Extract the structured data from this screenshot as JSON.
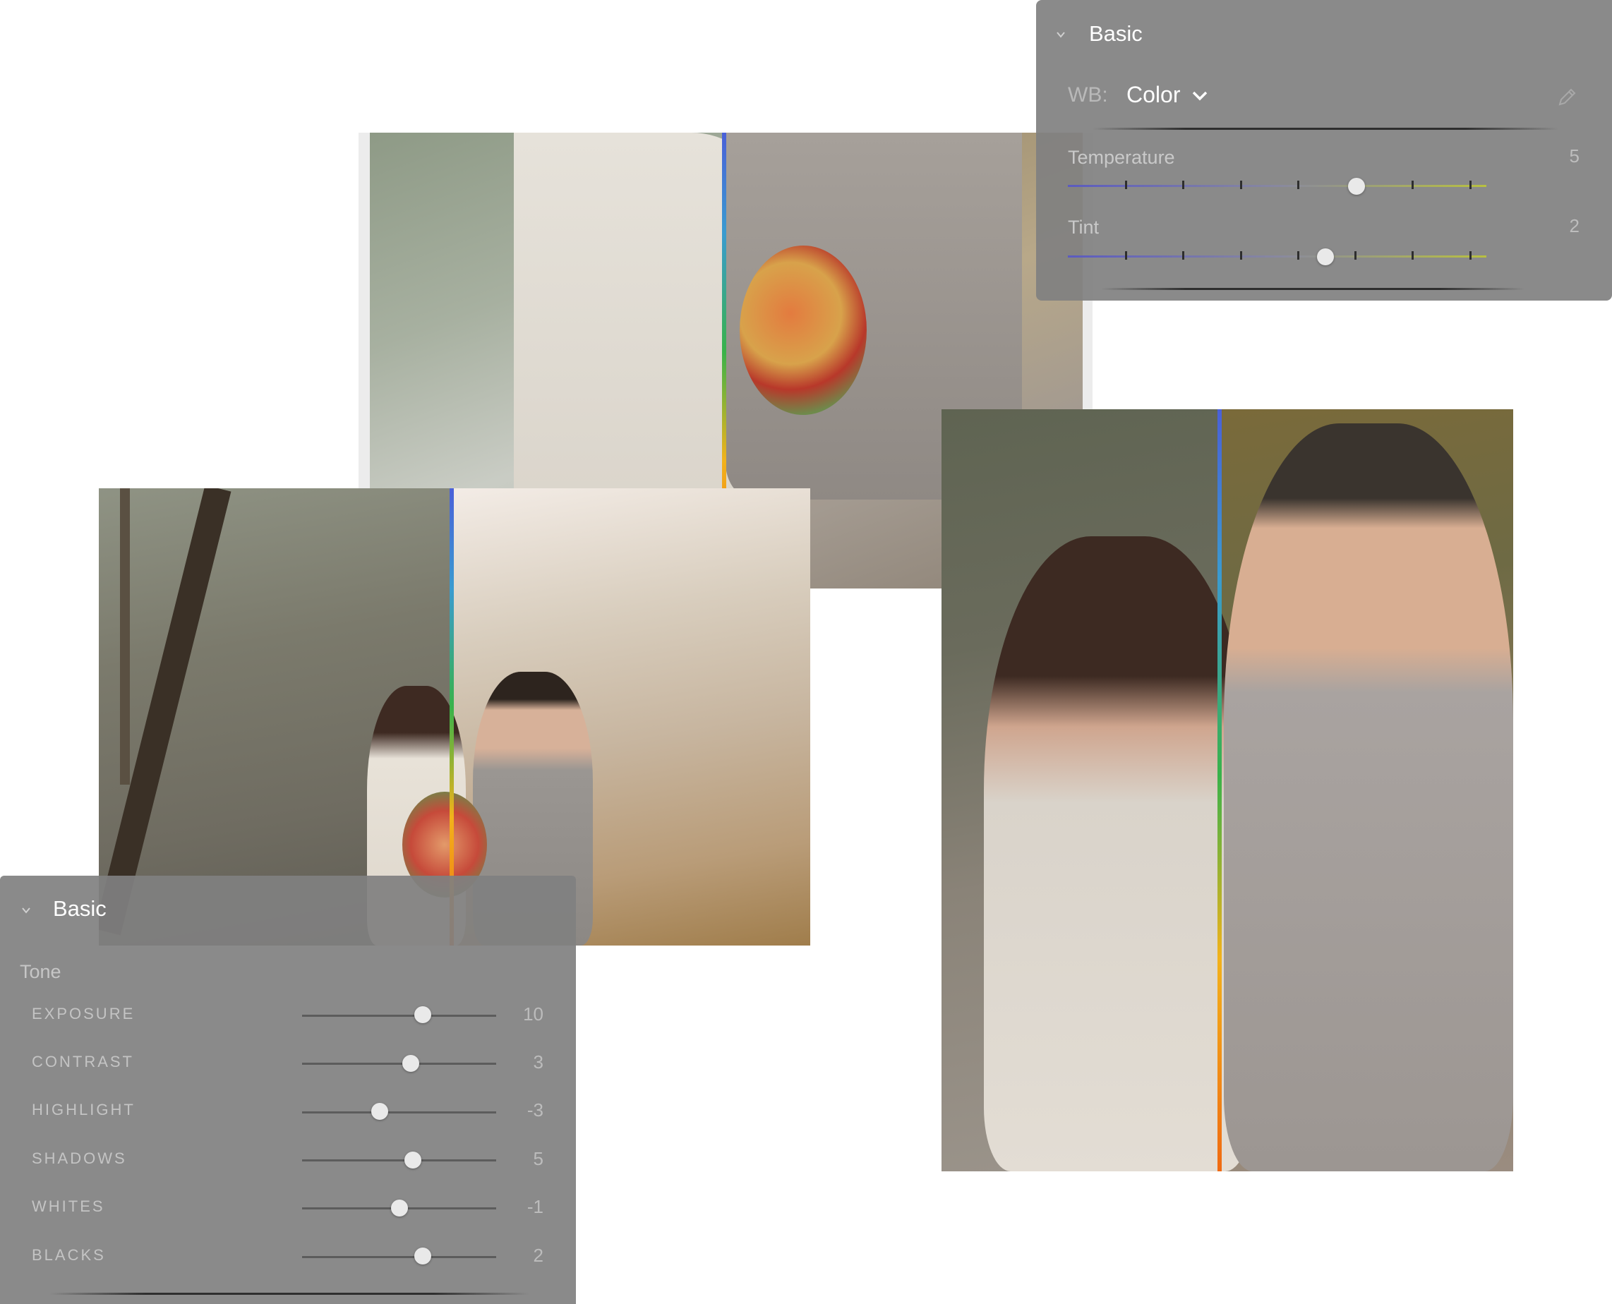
{
  "wb_panel": {
    "title": "Basic",
    "wb_label": "WB:",
    "wb_value": "Color",
    "sliders": [
      {
        "label": "Temperature",
        "value": "5",
        "level": 0.69
      },
      {
        "label": "Tint",
        "value": "2",
        "level": 0.615
      }
    ]
  },
  "tone_panel": {
    "title": "Basic",
    "section": "Tone",
    "sliders": [
      {
        "label": "EXPOSURE",
        "value": "10",
        "level": 0.62
      },
      {
        "label": "CONTRAST",
        "value": "3",
        "level": 0.56
      },
      {
        "label": "HIGHLIGHT",
        "value": "-3",
        "level": 0.4
      },
      {
        "label": "SHADOWS",
        "value": "5",
        "level": 0.57
      },
      {
        "label": "WHITES",
        "value": "-1",
        "level": 0.5
      },
      {
        "label": "BLACKS",
        "value": "2",
        "level": 0.62
      }
    ]
  },
  "colors": {
    "panel_bg": "#808080",
    "temperature_gradient": [
      "#5b5bc0",
      "#b8c040"
    ],
    "divider_gradient": [
      "#4a60d8",
      "#39b24a",
      "#f06a12"
    ]
  },
  "icons": [
    "chevron-down-icon",
    "eyedropper-icon"
  ]
}
